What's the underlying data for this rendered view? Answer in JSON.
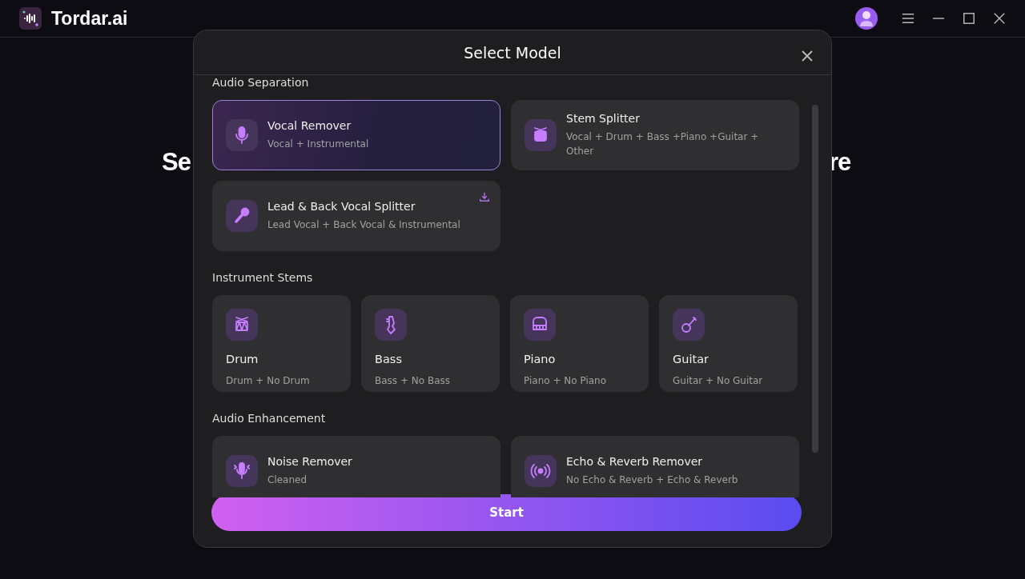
{
  "app": {
    "title": "Tordar.ai"
  },
  "background_heading": {
    "left": "Se",
    "right": "re"
  },
  "dialog": {
    "title": "Select Model",
    "sections": [
      {
        "title": "Audio Separation",
        "cards": [
          {
            "kind": "wide",
            "title": "Vocal Remover",
            "subtitle": "Vocal + Instrumental",
            "selected": true,
            "download": false
          },
          {
            "kind": "wide",
            "title": "Stem Splitter",
            "subtitle": "Vocal + Drum + Bass +Piano +Guitar + Other",
            "selected": false,
            "download": false
          },
          {
            "kind": "wide",
            "title": "Lead & Back Vocal Splitter",
            "subtitle": "Lead Vocal + Back Vocal & Instrumental",
            "selected": false,
            "download": true
          }
        ]
      },
      {
        "title": "Instrument Stems",
        "cards": [
          {
            "kind": "tile",
            "title": "Drum",
            "subtitle": "Drum + No Drum",
            "selected": false,
            "download": false
          },
          {
            "kind": "tile",
            "title": "Bass",
            "subtitle": "Bass + No Bass",
            "selected": false,
            "download": false
          },
          {
            "kind": "tile",
            "title": "Piano",
            "subtitle": "Piano + No Piano",
            "selected": false,
            "download": false
          },
          {
            "kind": "tile",
            "title": "Guitar",
            "subtitle": "Guitar + No Guitar",
            "selected": false,
            "download": false
          }
        ]
      },
      {
        "title": "Audio Enhancement",
        "cards": [
          {
            "kind": "wide",
            "title": "Noise Remover",
            "subtitle": "Cleaned",
            "selected": false,
            "download": false
          },
          {
            "kind": "wide",
            "title": "Echo & Reverb Remover",
            "subtitle": "No Echo & Reverb + Echo & Reverb",
            "selected": false,
            "download": false
          }
        ]
      }
    ],
    "start_button": "Start"
  }
}
